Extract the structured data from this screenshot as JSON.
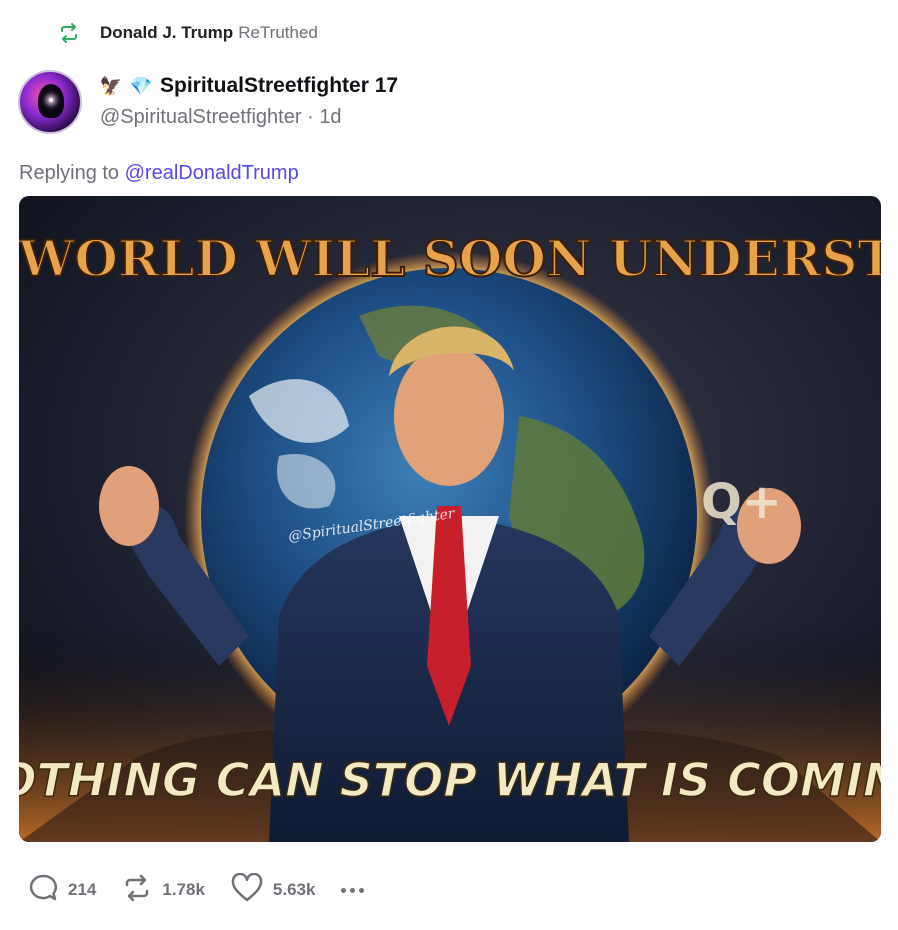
{
  "retruth": {
    "name": "Donald J. Trump",
    "tag": "ReTruthed",
    "icon": "retruth-icon",
    "icon_color": "#2fae60"
  },
  "author": {
    "emoji_1": "🦅",
    "emoji_2": "💎",
    "display_name": "SpiritualStreetfighter 17",
    "handle": "@SpiritualStreetfighter",
    "separator": "·",
    "time": "1d"
  },
  "reply": {
    "prefix": "Replying to",
    "mention": "@realDonaldTrump",
    "mention_color": "#5448ee"
  },
  "media": {
    "headline_top": "THE WORLD WILL SOON UNDERSTAND",
    "headline_bottom": "NOTHING CAN STOP WHAT IS COMING",
    "watermark": "@SpiritualStreetfighter",
    "q_mark": "Q+"
  },
  "actions": {
    "replies": "214",
    "retruths": "1.78k",
    "likes": "5.63k",
    "more_icon": "more-dots-icon"
  },
  "colors": {
    "muted": "#71717a",
    "accent": "#5448ee",
    "headline_fill": "#e8a24a",
    "headline_bottom_fill": "#f3e9c2"
  }
}
